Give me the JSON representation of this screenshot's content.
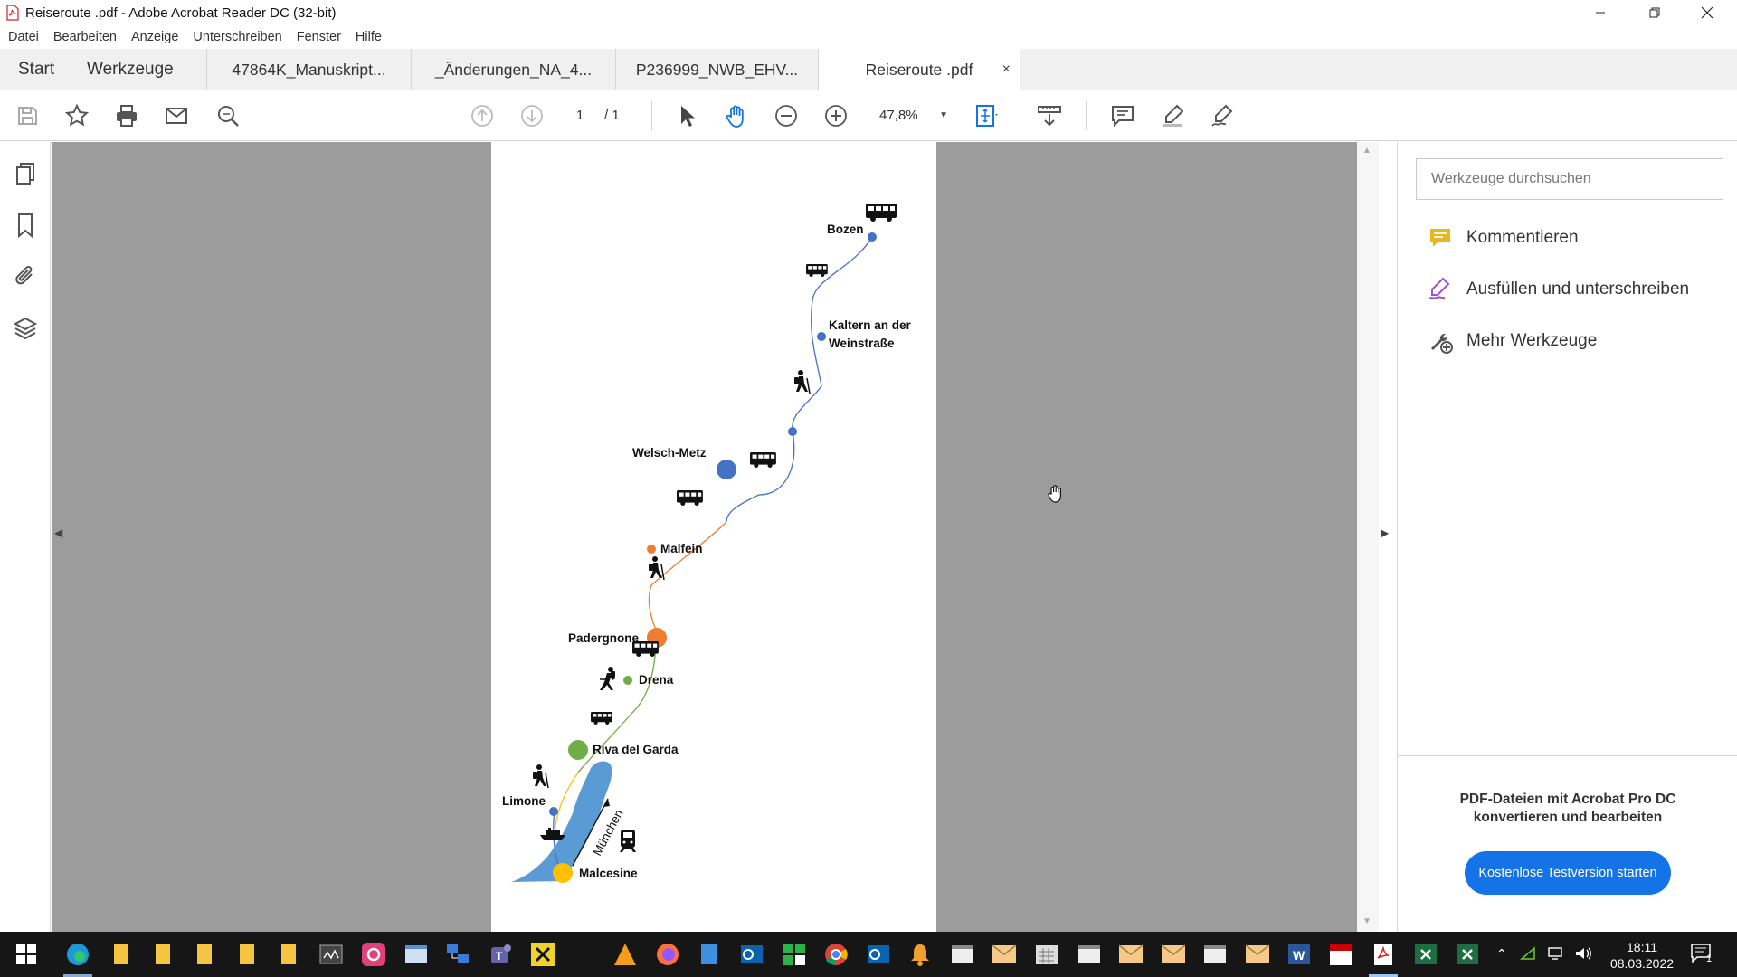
{
  "window": {
    "title": "Reiseroute .pdf - Adobe Acrobat Reader DC (32-bit)",
    "minimize_icon": "minimize-icon",
    "restore_icon": "restore-icon",
    "close_icon": "close-icon"
  },
  "menu": [
    "Datei",
    "Bearbeiten",
    "Anzeige",
    "Unterschreiben",
    "Fenster",
    "Hilfe"
  ],
  "tabs": {
    "start": "Start",
    "tools": "Werkzeuge",
    "documents": [
      {
        "label": "47864K_Manuskript..."
      },
      {
        "label": "_Änderungen_NA_4..."
      },
      {
        "label": "P236999_NWB_EHV..."
      },
      {
        "label": "Reiseroute .pdf",
        "active": true
      }
    ],
    "close_symbol": "×"
  },
  "toolbar": {
    "page_current": "1",
    "page_total": "/ 1",
    "zoom": "47,8%",
    "icons": [
      "save-icon",
      "star-icon",
      "print-icon",
      "mail-icon",
      "search-zoom-icon",
      "page-up-icon",
      "page-down-icon",
      "select-arrow-icon",
      "hand-icon",
      "zoom-out-icon",
      "zoom-in-icon",
      "fit-page-icon",
      "scroll-mode-icon",
      "comment-icon",
      "highlight-pen-icon",
      "sign-icon"
    ]
  },
  "left_nav": [
    "pages-icon",
    "bookmark-icon",
    "attachment-icon",
    "layers-icon"
  ],
  "right_panel": {
    "search_placeholder": "Werkzeuge durchsuchen",
    "tools": [
      {
        "label": "Kommentieren",
        "icon": "comment-tool-icon",
        "color": "#e8b81a"
      },
      {
        "label": "Ausfüllen und unterschreiben",
        "icon": "fill-sign-icon",
        "color": "#9b4fd6"
      },
      {
        "label": "Mehr Werkzeuge",
        "icon": "more-tools-icon",
        "color": "#555555"
      }
    ],
    "promo_text": "PDF-Dateien mit Acrobat Pro DC konvertieren und bearbeiten",
    "promo_button": "Kostenlose Testversion starten",
    "accent": "#1473e6"
  },
  "map": {
    "places": [
      "Bozen",
      "Kaltern an der Weinstraße",
      "Welsch-Metz",
      "Malfein",
      "Padergnone",
      "Drena",
      "Riva del Garda",
      "Limone",
      "Malcesine"
    ],
    "direction_label": "München",
    "colors": {
      "blue": "#4472c4",
      "orange": "#ed7d31",
      "green": "#70ad47",
      "yellow": "#ffc000",
      "lake": "#5b9bd5"
    }
  },
  "taskbar": {
    "time": "18:11",
    "date": "08.03.2022",
    "notification_count": "1"
  }
}
